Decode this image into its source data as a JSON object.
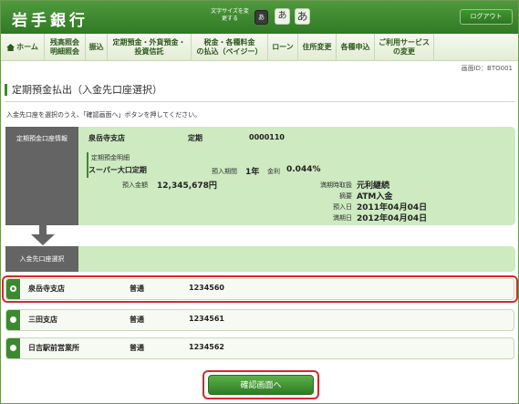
{
  "header": {
    "logo": "岩手銀行",
    "font_size_label": "文字サイズを変更する",
    "font_sizes": [
      "あ",
      "あ",
      "あ"
    ],
    "logout_label": "ログアウト"
  },
  "nav": {
    "items": [
      {
        "label": "ホーム",
        "icon": "home-icon"
      },
      {
        "label": "残高照会\n明細照会"
      },
      {
        "label": "振込"
      },
      {
        "label": "定期預金・外貨預金・\n投資信託"
      },
      {
        "label": "税金・各種料金\nの払込（ペイジー）"
      },
      {
        "label": "ローン"
      },
      {
        "label": "住所変更"
      },
      {
        "label": "各種申込"
      },
      {
        "label": "ご利用サービス\nの変更"
      }
    ]
  },
  "screen_id": "画面ID：BTO001",
  "page_title": "定期預金払出（入金先口座選択）",
  "instruction": "入金先口座を選択のうえ、「確認画面へ」ボタンを押してください。",
  "deposit_info": {
    "section_label": "定期預金口座情報",
    "branch": "泉岳寺支店",
    "type": "定期",
    "number": "0000110",
    "detail_title": "定期預金明細",
    "product": "スーパー大口定期",
    "term_label": "預入期間",
    "term_value": "1年",
    "rate_label": "金利",
    "rate_value": "0.044%",
    "amount_label": "預入金額",
    "amount_value": "12,345,678円",
    "maturity_handling_label": "満期時取扱",
    "maturity_handling_value": "元利継続",
    "memo_label": "摘要",
    "memo_value": "ATM入金",
    "deposit_date_label": "預入日",
    "deposit_date_value": "2011年04月04日",
    "maturity_date_label": "満期日",
    "maturity_date_value": "2012年04月04日"
  },
  "destination": {
    "section_label": "入金先口座選択",
    "accounts": [
      {
        "branch": "泉岳寺支店",
        "type": "普通",
        "number": "1234560",
        "selected": true
      },
      {
        "branch": "三田支店",
        "type": "普通",
        "number": "1234561",
        "selected": false
      },
      {
        "branch": "日吉駅前営業所",
        "type": "普通",
        "number": "1234562",
        "selected": false
      }
    ]
  },
  "confirm_label": "確認画面へ",
  "colors": {
    "brand_green": "#3c8a2e",
    "panel_green": "#cdeac0",
    "side_gray": "#646464",
    "highlight_red": "#d42a2a"
  }
}
